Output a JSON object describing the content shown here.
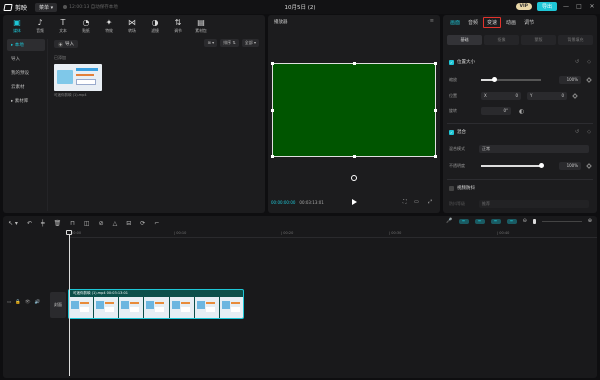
{
  "titlebar": {
    "brand": "剪映",
    "menu": "菜单 ▾",
    "autosave": "12:00:13 自动保存本地",
    "title": "10月5日 (2)",
    "vip": "VIP",
    "export": "导出",
    "win": [
      "—",
      "□",
      "✕"
    ]
  },
  "media_tools": [
    {
      "label": "媒体",
      "icon": "▣"
    },
    {
      "label": "音频",
      "icon": "♪"
    },
    {
      "label": "文本",
      "icon": "T"
    },
    {
      "label": "贴纸",
      "icon": "◔"
    },
    {
      "label": "特效",
      "icon": "✦"
    },
    {
      "label": "转场",
      "icon": "⋈"
    },
    {
      "label": "滤镜",
      "icon": "◑"
    },
    {
      "label": "调节",
      "icon": "⇅"
    },
    {
      "label": "素材包",
      "icon": "▤"
    }
  ],
  "sidebar": [
    {
      "label": "▸ 本地"
    },
    {
      "label": "导入"
    },
    {
      "label": "我的预设"
    },
    {
      "label": "云素材"
    },
    {
      "label": "▸ 素材库"
    }
  ],
  "media_main": {
    "import": "导入",
    "view1": "⊞ ▾",
    "sort": "排序 ⇅",
    "all": "全部 ▾",
    "added": "已添加",
    "thumb_name": "可迷你剪映 (1).mp4"
  },
  "player": {
    "title": "播放器",
    "menu": "≡",
    "tc_current": "00:00:00:00",
    "tc_total": "00:03:13:01",
    "ctrl1": "⛶",
    "ctrl2": "▭",
    "ctrl3": "⤢"
  },
  "props": {
    "tabs": [
      "画面",
      "音频",
      "变速",
      "动画",
      "调节"
    ],
    "subtabs": [
      "基础",
      "抠像",
      "蒙版",
      "背景填充"
    ],
    "pos_size": "位置大小",
    "scale_label": "缩放",
    "scale_value": 0.22,
    "scale_num": "100%",
    "pos_label": "位置",
    "pos_x_prefix": "X",
    "pos_x": "0",
    "pos_y_prefix": "Y",
    "pos_y": "0",
    "rotate_label": "旋转",
    "rotate": "0°",
    "blend": "混合",
    "blend_mode_label": "混合模式",
    "blend_mode": "正常",
    "opacity_label": "不透明度",
    "opacity_value": 1.0,
    "opacity_num": "100%",
    "stabilize": "视频防抖",
    "stabilize_label": "防抖等级",
    "stabilize_value": "推荐"
  },
  "timeline": {
    "tools": [
      "↖ ▾",
      "↶",
      "╪",
      "🗑",
      "⊓",
      "◫",
      "⊘",
      "△",
      "⊟",
      "⟳",
      "⌐"
    ],
    "right_icons": [
      "🎤",
      "⇹",
      "⇹",
      "⇹",
      "⇹",
      "⊖",
      "⊕"
    ],
    "ticks": [
      "00:00",
      "| 00:10",
      "| 00:20",
      "| 00:30",
      "| 00:40"
    ],
    "cover": "封面",
    "track_icons": [
      "▭",
      "🔒",
      "👁",
      "🔊"
    ],
    "clip_title": "可迷你剪映 (1).mp4  00:03:13:01"
  },
  "colors": {
    "accent": "#1ec6d6",
    "canvas": "#005500",
    "highlight_box": "#e2332c"
  }
}
